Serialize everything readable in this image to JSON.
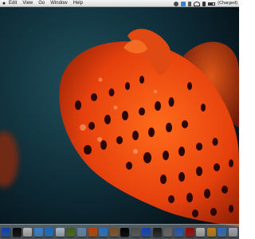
{
  "menubar": {
    "apple_icon": "apple-icon",
    "items": [
      "Edit",
      "View",
      "Go",
      "Window",
      "Help"
    ],
    "status": {
      "battery_label": "(Charged)",
      "user_label": "",
      "icons": [
        "sync-icon",
        "tmachine-icon",
        "bluetooth-icon",
        "wifi-icon",
        "volume-icon",
        "battery-icon"
      ]
    }
  },
  "dock": {
    "icons": [
      {
        "name": "finder",
        "color": "#3a7bd5"
      },
      {
        "name": "dashboard",
        "color": "#2a2a2a"
      },
      {
        "name": "ical",
        "color": "#d9d9d9"
      },
      {
        "name": "itunes",
        "color": "#6fb3e8"
      },
      {
        "name": "safari",
        "color": "#4aa3df"
      },
      {
        "name": "mail",
        "color": "#cfd8e0"
      },
      {
        "name": "photos",
        "color": "#7a9a4a"
      },
      {
        "name": "preview",
        "color": "#9bb6cf"
      },
      {
        "name": "firefox",
        "color": "#e07b2a"
      },
      {
        "name": "chat",
        "color": "#5fa8e0"
      },
      {
        "name": "address",
        "color": "#b38b5a"
      },
      {
        "name": "terminal",
        "color": "#1a1a1a"
      },
      {
        "name": "system-prefs",
        "color": "#8a8a8a"
      },
      {
        "name": "app-store",
        "color": "#3d7dd8"
      },
      {
        "name": "facetime",
        "color": "#4c4c4c"
      },
      {
        "name": "utility",
        "color": "#9a9a9a"
      },
      {
        "name": "folder",
        "color": "#5a8fd0"
      },
      {
        "name": "photobooth",
        "color": "#c0392b"
      },
      {
        "name": "misc1",
        "color": "#d4d4d4"
      },
      {
        "name": "misc2",
        "color": "#e0b040"
      },
      {
        "name": "downloads",
        "color": "#6aa0d8"
      },
      {
        "name": "trash",
        "color": "#c9cdd2"
      }
    ]
  }
}
